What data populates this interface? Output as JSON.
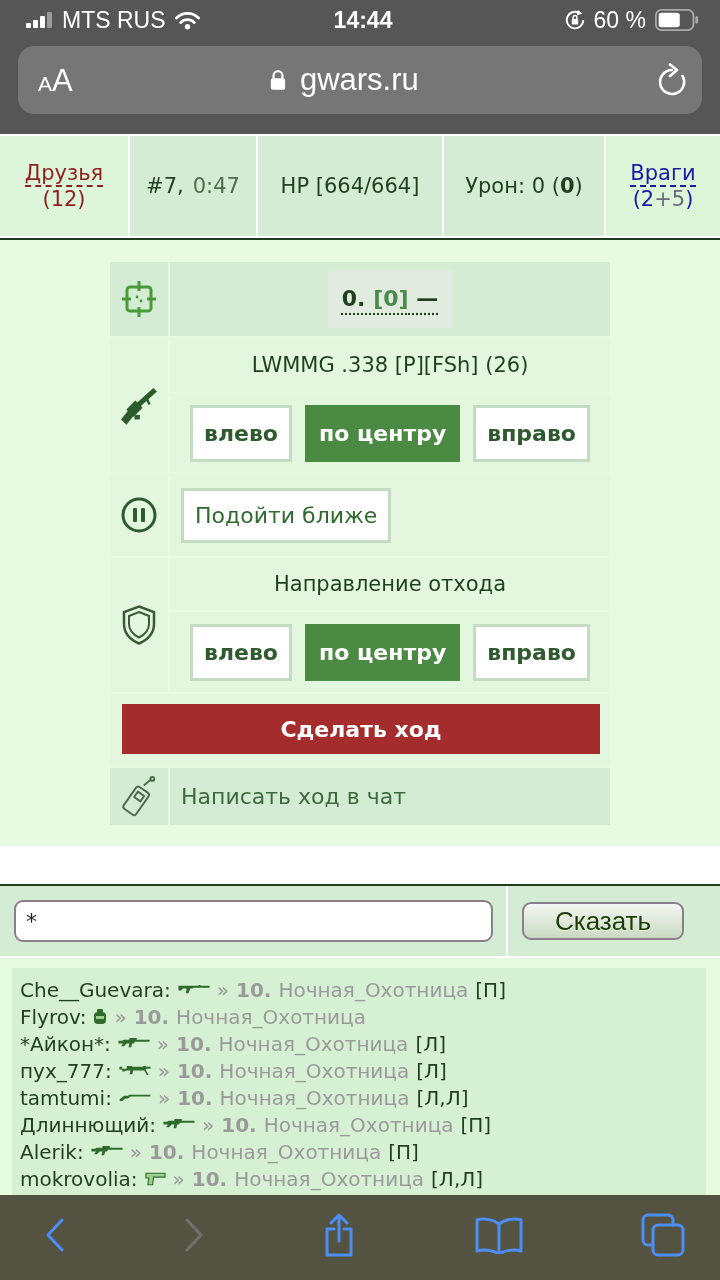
{
  "status_bar": {
    "carrier": "MTS RUS",
    "time": "14:44",
    "battery_text": "60 %"
  },
  "browser": {
    "reader_button": "AA",
    "url": "gwars.ru"
  },
  "battle_header": {
    "friends": {
      "label": "Друзья",
      "count": "(12)"
    },
    "round": "#7,",
    "timer": "0:47",
    "hp": "HP [664/664]",
    "damage": "Урон: 0 (**0**)",
    "enemies": {
      "label": "Враги",
      "count_parts": [
        {
          "text": "(2",
          "kind": "main"
        },
        {
          "text": "+5",
          "kind": "extra"
        },
        {
          "text": ")",
          "kind": "main"
        }
      ]
    }
  },
  "target": {
    "parts": [
      {
        "text": "0.",
        "kind": "number"
      },
      {
        "text": "[0]",
        "kind": "hp"
      },
      {
        "text": "—",
        "kind": "name"
      }
    ]
  },
  "weapon": {
    "name": "LWMMG .338 [P][FSh] (26)",
    "aim": [
      {
        "label": "влево",
        "selected": false
      },
      {
        "label": "по центру",
        "selected": true
      },
      {
        "label": "вправо",
        "selected": false
      }
    ]
  },
  "approach_button": "Подойти ближе",
  "retreat": {
    "title": "Направление отхода",
    "options": [
      {
        "label": "влево",
        "selected": false
      },
      {
        "label": "по центру",
        "selected": true
      },
      {
        "label": "вправо",
        "selected": false
      }
    ]
  },
  "make_move_button": "Сделать ход",
  "chat_move_link": "Написать ход в чат",
  "chat": {
    "input_value": "*",
    "send_button": "Сказать"
  },
  "log": [
    {
      "name": "Che__Guevara:",
      "kind": "rifle",
      "arrow": "»",
      "number": "10.",
      "target": "Ночная_Охотница",
      "tag": "[П]"
    },
    {
      "name": "Flyrov:",
      "kind": "grenade",
      "arrow": "»",
      "number": "10.",
      "target": "Ночная_Охотница"
    },
    {
      "name": "*Айкон*:",
      "kind": "assault",
      "arrow": "»",
      "number": "10.",
      "target": "Ночная_Охотница",
      "tag": "[Л]"
    },
    {
      "name": "пух_777:",
      "kind": "machinegun",
      "arrow": "»",
      "number": "10.",
      "target": "Ночная_Охотница",
      "tag": "[Л]"
    },
    {
      "name": "tamtumi:",
      "kind": "shotgun",
      "arrow": "»",
      "number": "10.",
      "target": "Ночная_Охотница",
      "tag": "[Л,Л]"
    },
    {
      "name": "Длиннющий:",
      "kind": "assault",
      "arrow": "»",
      "number": "10.",
      "target": "Ночная_Охотница",
      "tag": "[П]"
    },
    {
      "name": "Alerik:",
      "kind": "assault",
      "arrow": "»",
      "number": "10.",
      "target": "Ночная_Охотница",
      "tag": "[П]"
    },
    {
      "name": "mokrovolia:",
      "kind": "pistol",
      "arrow": "»",
      "number": "10.",
      "target": "Ночная_Охотница",
      "tag": "[Л,Л]"
    }
  ],
  "toolbar": [
    {
      "kind": "back",
      "disabled": false
    },
    {
      "kind": "forward",
      "disabled": true
    },
    {
      "kind": "share",
      "disabled": false
    },
    {
      "kind": "bookmarks",
      "disabled": false
    },
    {
      "kind": "tabs",
      "disabled": false
    }
  ]
}
